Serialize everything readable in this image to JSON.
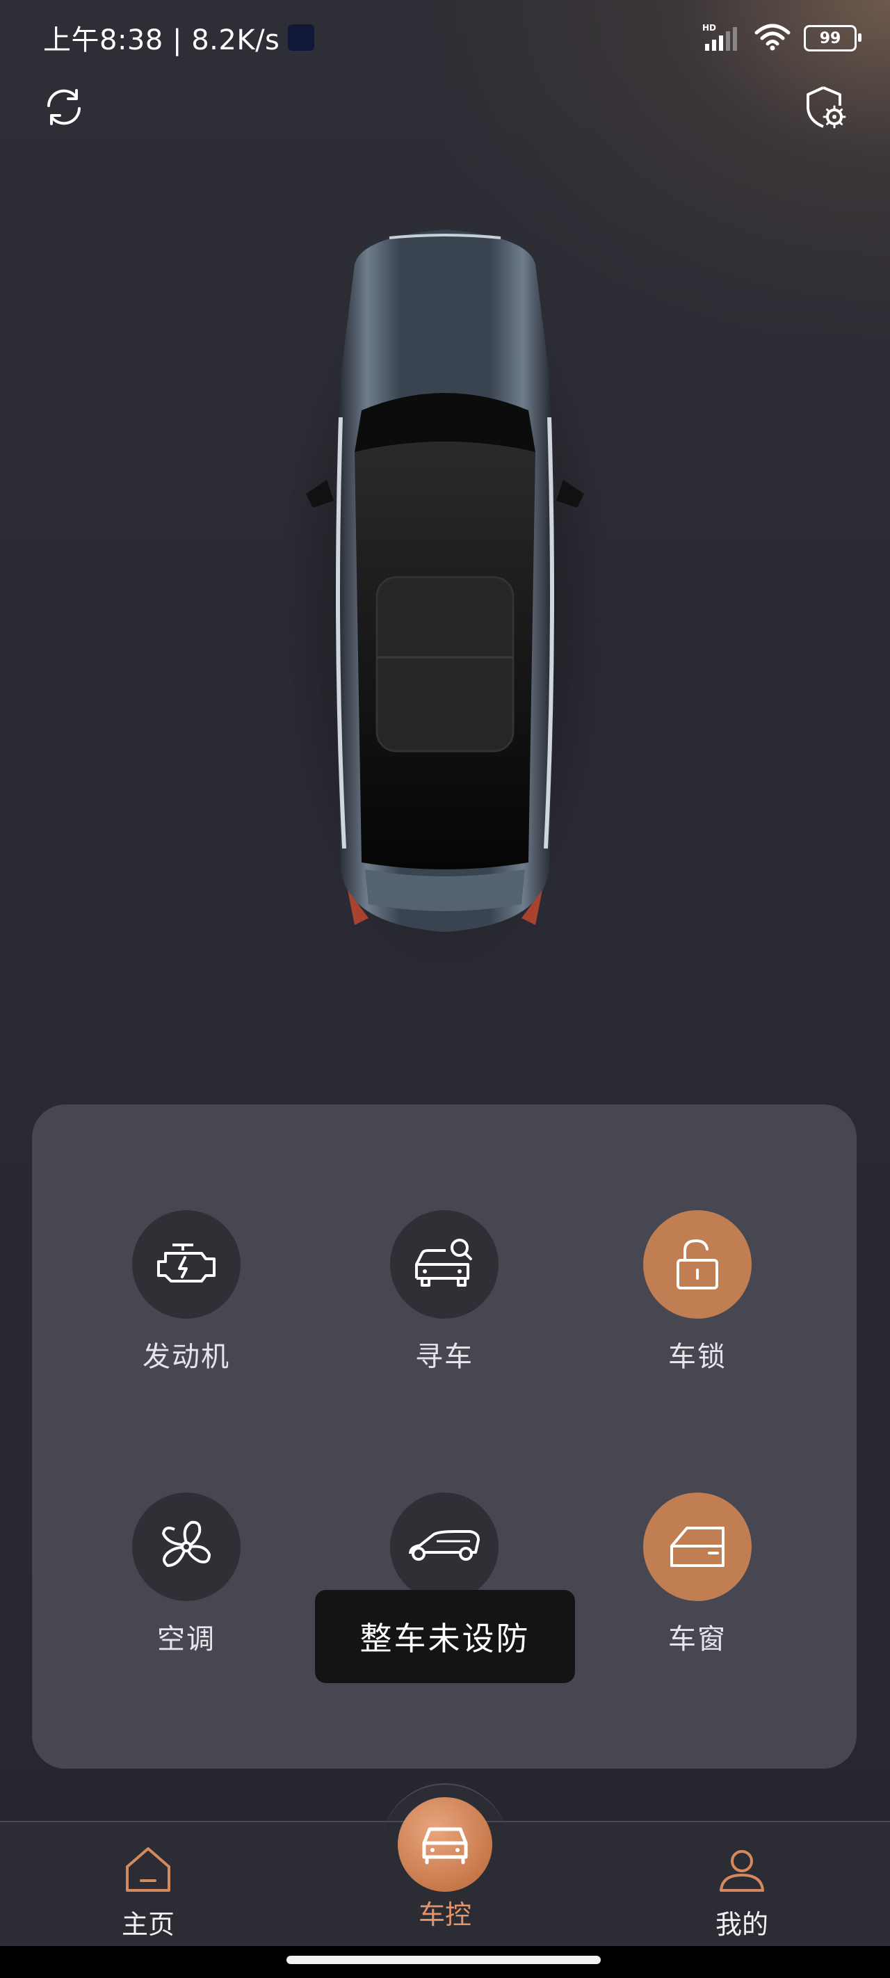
{
  "status_bar": {
    "time_speed": "上午8:38 | 8.2K/s",
    "network_badge": "HD",
    "battery": "99"
  },
  "header": {
    "refresh_icon": "refresh-icon",
    "settings_icon": "shield-gear-icon"
  },
  "controls": [
    {
      "label": "发动机",
      "icon": "engine-icon",
      "active": false
    },
    {
      "label": "寻车",
      "icon": "find-car-icon",
      "active": false
    },
    {
      "label": "车锁",
      "icon": "unlock-icon",
      "active": true
    },
    {
      "label": "空调",
      "icon": "fan-icon",
      "active": false
    },
    {
      "label": "",
      "icon": "trunk-car-icon",
      "active": false
    },
    {
      "label": "车窗",
      "icon": "window-icon",
      "active": true
    }
  ],
  "toast": "整车未设防",
  "nav": {
    "home": "主页",
    "control": "车控",
    "mine": "我的"
  },
  "colors": {
    "accent": "#c07e52",
    "nav_active": "#e2946a",
    "panel": "#474752",
    "circle": "#2f2f36"
  }
}
